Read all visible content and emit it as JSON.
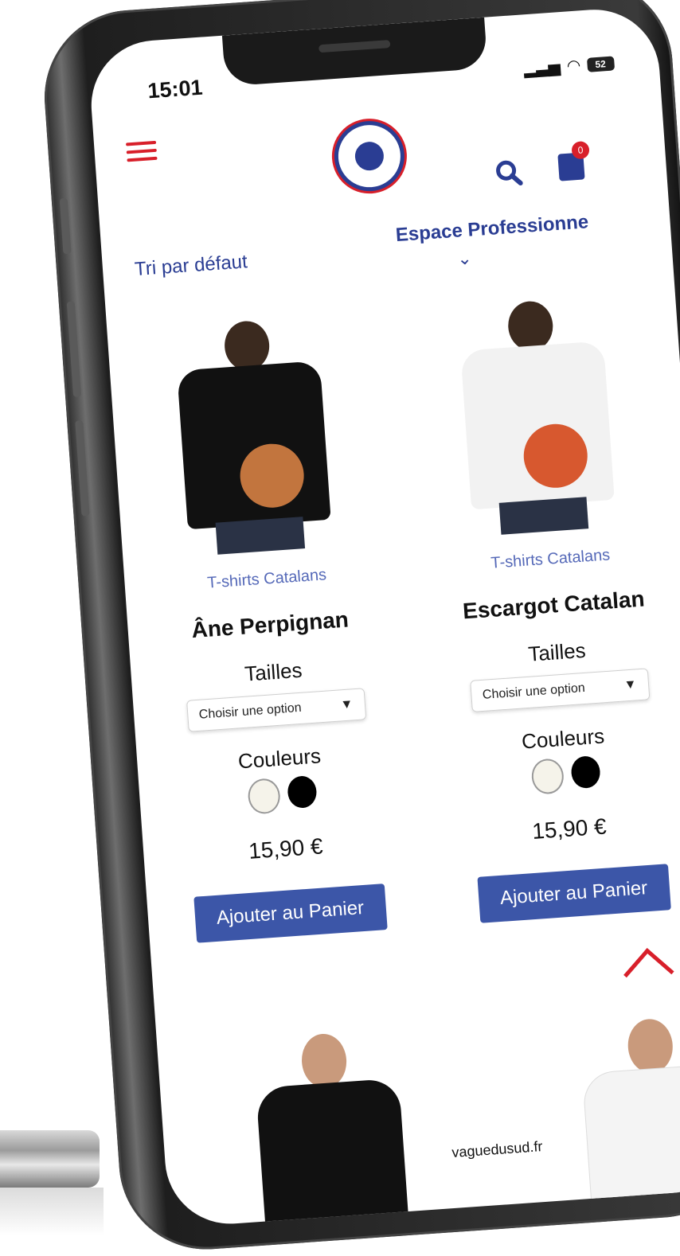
{
  "status_bar": {
    "time": "15:01",
    "battery": "52"
  },
  "header": {
    "menu_icon": "hamburger-icon",
    "logo_icon": "brand-logo",
    "search_icon": "search-icon",
    "cart_icon": "shopping-bag-icon",
    "cart_count": "0",
    "sort_label": "Tri par défaut",
    "pro_link": "Espace Professionne"
  },
  "products": [
    {
      "category": "T-shirts Catalans",
      "name": "Âne Perpignan",
      "sizes_label": "Tailles",
      "size_select": "Choisir une option",
      "colors_label": "Couleurs",
      "price": "15,90 €",
      "add_button": "Ajouter au Panier",
      "shirt_color": "#111111"
    },
    {
      "category": "T-shirts Catalans",
      "name": "Escargot Catalan",
      "sizes_label": "Tailles",
      "size_select": "Choisir une option",
      "colors_label": "Couleurs",
      "price": "15,90 €",
      "add_button": "Ajouter au Panier",
      "shirt_color": "#f2f2f2"
    }
  ],
  "footer": {
    "domain": "vaguedusud.fr"
  },
  "colors": {
    "brand_blue": "#2a3d93",
    "accent_red": "#d81f2a",
    "button_blue": "#3c56a8"
  }
}
